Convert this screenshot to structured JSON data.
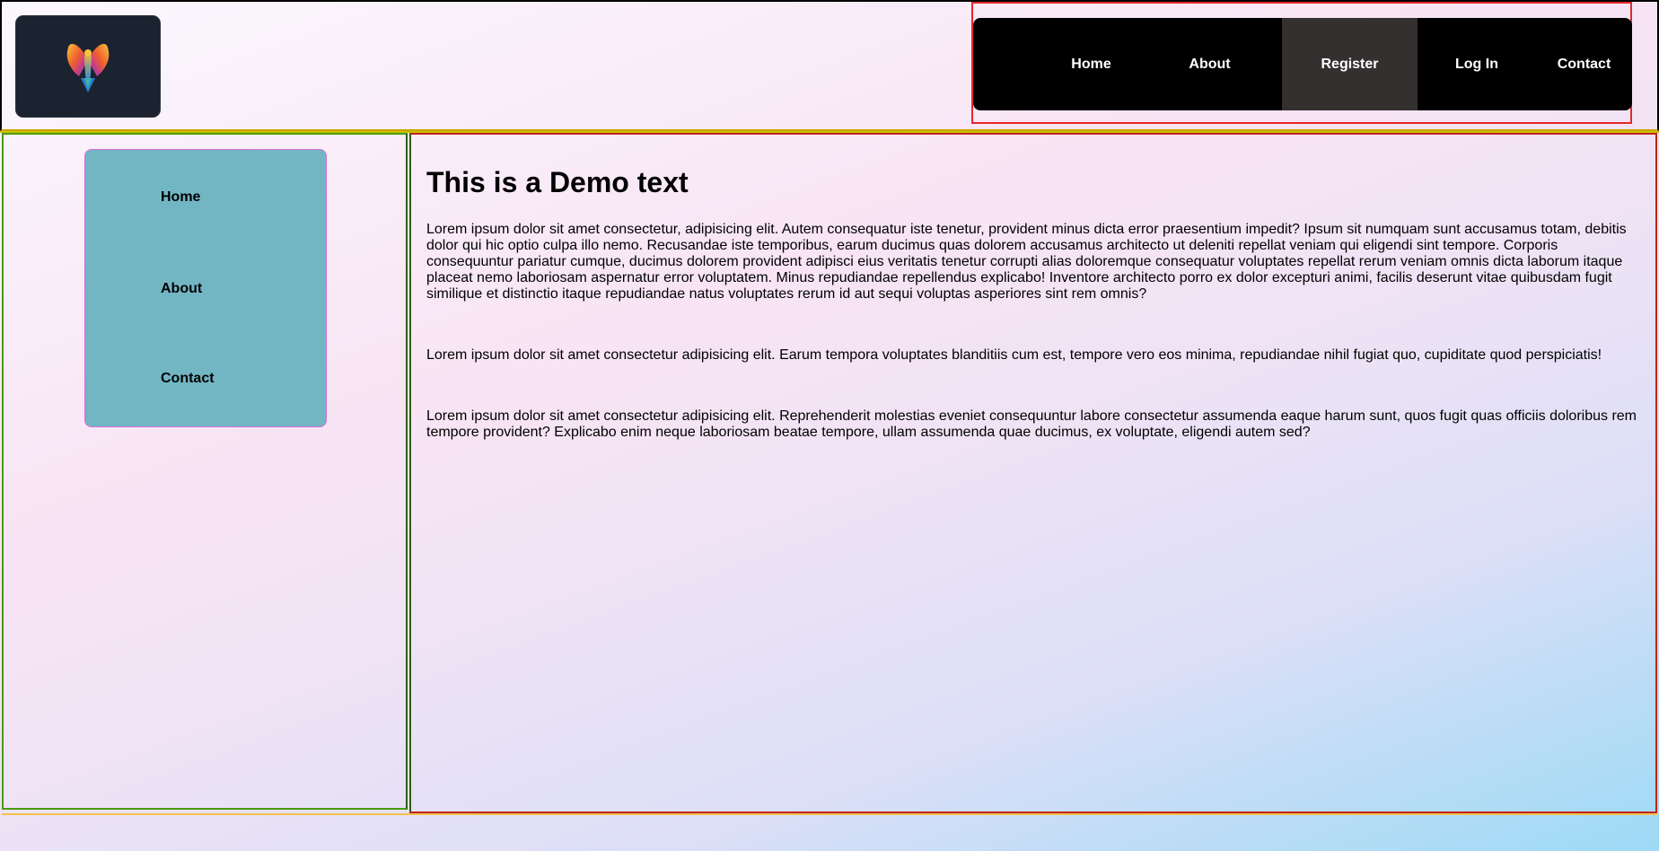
{
  "header": {
    "logo": {
      "icon": "phoenix-logo-icon"
    },
    "nav": [
      {
        "label": "Home",
        "active": false
      },
      {
        "label": "About",
        "active": false
      },
      {
        "label": "Register",
        "active": true
      },
      {
        "label": "Log In",
        "active": false
      },
      {
        "label": "Contact",
        "active": false
      }
    ]
  },
  "sidebar": {
    "items": [
      {
        "label": "Home"
      },
      {
        "label": "About"
      },
      {
        "label": "Contact"
      }
    ]
  },
  "main": {
    "title": "This is a Demo text",
    "paragraphs": [
      "Lorem ipsum dolor sit amet consectetur, adipisicing elit. Autem consequatur iste tenetur, provident minus dicta error praesentium impedit? Ipsum sit numquam sunt accusamus totam, debitis dolor qui hic optio culpa illo nemo. Recusandae iste temporibus, earum ducimus quas dolorem accusamus architecto ut deleniti repellat veniam qui eligendi sint tempore. Corporis consequuntur pariatur cumque, ducimus dolorem provident adipisci eius veritatis tenetur corrupti alias doloremque consequatur voluptates repellat rerum veniam omnis dicta laborum itaque placeat nemo laboriosam aspernatur error voluptatem. Minus repudiandae repellendus explicabo! Inventore architecto porro ex dolor excepturi animi, facilis deserunt vitae quibusdam fugit similique et distinctio itaque repudiandae natus voluptates rerum id aut sequi voluptas asperiores sint rem omnis?",
      "Lorem ipsum dolor sit amet consectetur adipisicing elit. Earum tempora voluptates blanditiis cum est, tempore vero eos minima, repudiandae nihil fugiat quo, cupiditate quod perspiciatis!",
      "Lorem ipsum dolor sit amet consectetur adipisicing elit. Reprehenderit molestias eveniet consequuntur labore consectetur assumenda eaque harum sunt, quos fugit quas officiis doloribus rem tempore provident? Explicabo enim neque laboriosam beatae tempore, ullam assumenda quae ducimus, ex voluptate, eligendi autem sed?"
    ]
  },
  "colors": {
    "nav_bg": "#000000",
    "nav_active_bg": "#343030",
    "side_menu_bg": "#72b6c4",
    "logo_bg": "#1c2330"
  }
}
